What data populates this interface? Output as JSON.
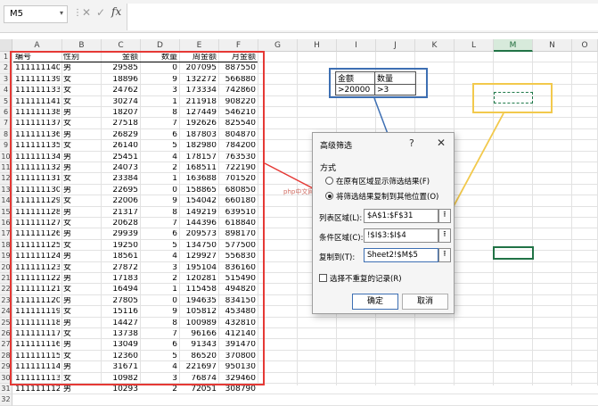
{
  "formula_bar": {
    "name_box": "M5",
    "cancel_icon": "✕",
    "enter_icon": "✓",
    "fx_label": "fx",
    "formula": ""
  },
  "columns": [
    "A",
    "B",
    "C",
    "D",
    "E",
    "F",
    "G",
    "H",
    "I",
    "J",
    "K",
    "L",
    "M",
    "N",
    "O"
  ],
  "selected_column": "M",
  "rows": [
    "1",
    "2",
    "3",
    "4",
    "5",
    "6",
    "7",
    "8",
    "9",
    "10",
    "11",
    "12",
    "13",
    "14",
    "15",
    "16",
    "17",
    "18",
    "19",
    "20",
    "21",
    "22",
    "23",
    "24",
    "25",
    "26",
    "27",
    "28",
    "29",
    "30",
    "31",
    "32"
  ],
  "sheet": {
    "headers": [
      "编号",
      "性别",
      "金额",
      "数量",
      "周金额",
      "月金额"
    ],
    "records": [
      [
        "111111140",
        "男",
        "29585",
        "0",
        "207095",
        "887550"
      ],
      [
        "111111139",
        "女",
        "18896",
        "9",
        "132272",
        "566880"
      ],
      [
        "111111133",
        "女",
        "24762",
        "3",
        "173334",
        "742860"
      ],
      [
        "111111141",
        "女",
        "30274",
        "1",
        "211918",
        "908220"
      ],
      [
        "111111138",
        "男",
        "18207",
        "8",
        "127449",
        "546210"
      ],
      [
        "111111137",
        "女",
        "27518",
        "7",
        "192626",
        "825540"
      ],
      [
        "111111136",
        "男",
        "26829",
        "6",
        "187803",
        "804870"
      ],
      [
        "111111135",
        "女",
        "26140",
        "5",
        "182980",
        "784200"
      ],
      [
        "111111134",
        "男",
        "25451",
        "4",
        "178157",
        "763530"
      ],
      [
        "111111132",
        "男",
        "24073",
        "2",
        "168511",
        "722190"
      ],
      [
        "111111131",
        "女",
        "23384",
        "1",
        "163688",
        "701520"
      ],
      [
        "111111130",
        "男",
        "22695",
        "0",
        "158865",
        "680850"
      ],
      [
        "111111129",
        "女",
        "22006",
        "9",
        "154042",
        "660180"
      ],
      [
        "111111128",
        "男",
        "21317",
        "8",
        "149219",
        "639510"
      ],
      [
        "111111127",
        "女",
        "20628",
        "7",
        "144396",
        "618840"
      ],
      [
        "111111126",
        "男",
        "29939",
        "6",
        "209573",
        "898170"
      ],
      [
        "111111125",
        "女",
        "19250",
        "5",
        "134750",
        "577500"
      ],
      [
        "111111124",
        "男",
        "18561",
        "4",
        "129927",
        "556830"
      ],
      [
        "111111123",
        "女",
        "27872",
        "3",
        "195104",
        "836160"
      ],
      [
        "111111122",
        "男",
        "17183",
        "2",
        "120281",
        "515490"
      ],
      [
        "111111121",
        "女",
        "16494",
        "1",
        "115458",
        "494820"
      ],
      [
        "111111120",
        "男",
        "27805",
        "0",
        "194635",
        "834150"
      ],
      [
        "111111119",
        "女",
        "15116",
        "9",
        "105812",
        "453480"
      ],
      [
        "111111118",
        "男",
        "14427",
        "8",
        "100989",
        "432810"
      ],
      [
        "111111117",
        "女",
        "13738",
        "7",
        "96166",
        "412140"
      ],
      [
        "111111116",
        "男",
        "13049",
        "6",
        "91343",
        "391470"
      ],
      [
        "111111115",
        "女",
        "12360",
        "5",
        "86520",
        "370800"
      ],
      [
        "111111114",
        "男",
        "31671",
        "4",
        "221697",
        "950130"
      ],
      [
        "111111113",
        "女",
        "10982",
        "3",
        "76874",
        "329460"
      ],
      [
        "111111112",
        "男",
        "10293",
        "2",
        "72051",
        "308790"
      ]
    ]
  },
  "criteria": {
    "header": [
      "金额",
      "数量"
    ],
    "values": [
      ">20000",
      ">3"
    ]
  },
  "watermark": "php中文网",
  "colors": {
    "red_box": "#e53935",
    "blue_box": "#3d6fb3",
    "yellow_box": "#f2c94c",
    "excel_green": "#217346"
  },
  "dialog": {
    "title": "高级筛选",
    "help_icon": "?",
    "close_icon": "✕",
    "section_label": "方式",
    "option1": "在原有区域显示筛选结果(F)",
    "option2": "将筛选结果复制到其他位置(O)",
    "list_range_label": "列表区域(L):",
    "list_range_value": "$A$1:$F$31",
    "criteria_range_label": "条件区域(C):",
    "criteria_range_value": "!$I$3:$I$4",
    "copy_to_label": "复制到(T):",
    "copy_to_value": "Sheet2!$M$5",
    "unique_label": "选择不重复的记录(R)",
    "ok_label": "确定",
    "cancel_label": "取消"
  }
}
